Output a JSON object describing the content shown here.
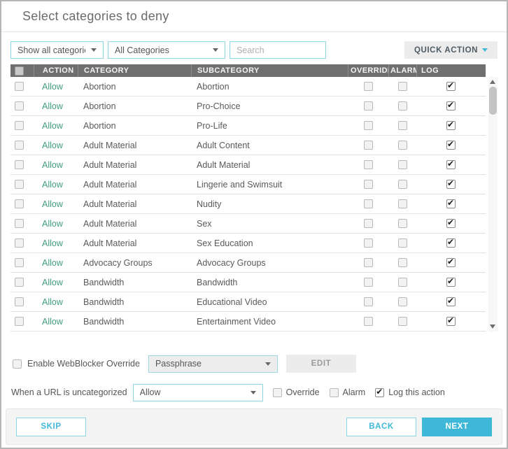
{
  "title": "Select categories to deny",
  "filters": {
    "show_select_value": "Show all categories",
    "category_select_value": "All Categories",
    "search_placeholder": "Search",
    "quick_action_label": "QUICK ACTION"
  },
  "table": {
    "columns": [
      "ACTION",
      "CATEGORY",
      "SUBCATEGORY",
      "OVERRIDE",
      "ALARM",
      "LOG"
    ],
    "select_all_checked": false,
    "rows": [
      {
        "selected": false,
        "action": "Allow",
        "category": "Abortion",
        "subcategory": "Abortion",
        "override": false,
        "alarm": false,
        "log": true
      },
      {
        "selected": false,
        "action": "Allow",
        "category": "Abortion",
        "subcategory": "Pro-Choice",
        "override": false,
        "alarm": false,
        "log": true
      },
      {
        "selected": false,
        "action": "Allow",
        "category": "Abortion",
        "subcategory": "Pro-Life",
        "override": false,
        "alarm": false,
        "log": true
      },
      {
        "selected": false,
        "action": "Allow",
        "category": "Adult Material",
        "subcategory": "Adult Content",
        "override": false,
        "alarm": false,
        "log": true
      },
      {
        "selected": false,
        "action": "Allow",
        "category": "Adult Material",
        "subcategory": "Adult Material",
        "override": false,
        "alarm": false,
        "log": true
      },
      {
        "selected": false,
        "action": "Allow",
        "category": "Adult Material",
        "subcategory": "Lingerie and Swimsuit",
        "override": false,
        "alarm": false,
        "log": true
      },
      {
        "selected": false,
        "action": "Allow",
        "category": "Adult Material",
        "subcategory": "Nudity",
        "override": false,
        "alarm": false,
        "log": true
      },
      {
        "selected": false,
        "action": "Allow",
        "category": "Adult Material",
        "subcategory": "Sex",
        "override": false,
        "alarm": false,
        "log": true
      },
      {
        "selected": false,
        "action": "Allow",
        "category": "Adult Material",
        "subcategory": "Sex Education",
        "override": false,
        "alarm": false,
        "log": true
      },
      {
        "selected": false,
        "action": "Allow",
        "category": "Advocacy Groups",
        "subcategory": "Advocacy Groups",
        "override": false,
        "alarm": false,
        "log": true
      },
      {
        "selected": false,
        "action": "Allow",
        "category": "Bandwidth",
        "subcategory": "Bandwidth",
        "override": false,
        "alarm": false,
        "log": true
      },
      {
        "selected": false,
        "action": "Allow",
        "category": "Bandwidth",
        "subcategory": "Educational Video",
        "override": false,
        "alarm": false,
        "log": true
      },
      {
        "selected": false,
        "action": "Allow",
        "category": "Bandwidth",
        "subcategory": "Entertainment Video",
        "override": false,
        "alarm": false,
        "log": true
      }
    ]
  },
  "webblocker_override": {
    "checkbox_label": "Enable WebBlocker Override",
    "enabled": false,
    "method_select_value": "Passphrase",
    "edit_label": "EDIT"
  },
  "uncategorized": {
    "label": "When a URL is uncategorized",
    "action_select_value": "Allow",
    "override_label": "Override",
    "override_checked": false,
    "alarm_label": "Alarm",
    "alarm_checked": false,
    "log_label": "Log this action",
    "log_checked": true
  },
  "footer": {
    "skip_label": "SKIP",
    "back_label": "BACK",
    "next_label": "NEXT"
  },
  "colors": {
    "accent_teal": "#3fb8d8",
    "input_border_teal": "#8fd6e3",
    "allow_green": "#3f9e7c",
    "table_header_bg": "#6f6f6f"
  }
}
